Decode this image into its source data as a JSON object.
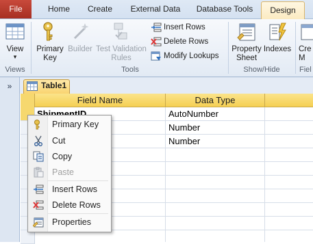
{
  "ribbon_tabs": {
    "file": "File",
    "home": "Home",
    "create": "Create",
    "external_data": "External Data",
    "database_tools": "Database Tools",
    "design": "Design"
  },
  "ribbon": {
    "view_label": "View",
    "views_group": "Views",
    "primary_key_line1": "Primary",
    "primary_key_line2": "Key",
    "builder_label": "Builder",
    "test_line1": "Test Validation",
    "test_line2": "Rules",
    "insert_rows": "Insert Rows",
    "delete_rows": "Delete Rows",
    "modify_lookups": "Modify Lookups",
    "tools_group": "Tools",
    "property_line1": "Property",
    "property_line2": "Sheet",
    "indexes_label": "Indexes",
    "showhide_group": "Show/Hide",
    "cut_line1": "Cre",
    "cut_line2": "M",
    "cut_group": "Fiel"
  },
  "nav": {
    "toggle": "»"
  },
  "document_tab": {
    "label": "Table1"
  },
  "grid": {
    "headers": {
      "field_name": "Field Name",
      "data_type": "Data Type"
    },
    "rows": [
      {
        "field": "ShipmentID",
        "type": "AutoNumber"
      },
      {
        "field": "",
        "type": "Number"
      },
      {
        "field": "",
        "type": "Number"
      }
    ]
  },
  "context_menu": {
    "items": [
      {
        "label": "Primary Key",
        "enabled": true,
        "icon": "key-icon"
      },
      {
        "label": "Cut",
        "enabled": true,
        "icon": "scissors-icon"
      },
      {
        "label": "Copy",
        "enabled": true,
        "icon": "copy-icon"
      },
      {
        "label": "Paste",
        "enabled": false,
        "icon": "paste-icon"
      },
      {
        "label": "Insert Rows",
        "enabled": true,
        "icon": "insert-rows-icon"
      },
      {
        "label": "Delete Rows",
        "enabled": true,
        "icon": "delete-rows-icon"
      },
      {
        "label": "Properties",
        "enabled": true,
        "icon": "properties-icon"
      }
    ]
  }
}
